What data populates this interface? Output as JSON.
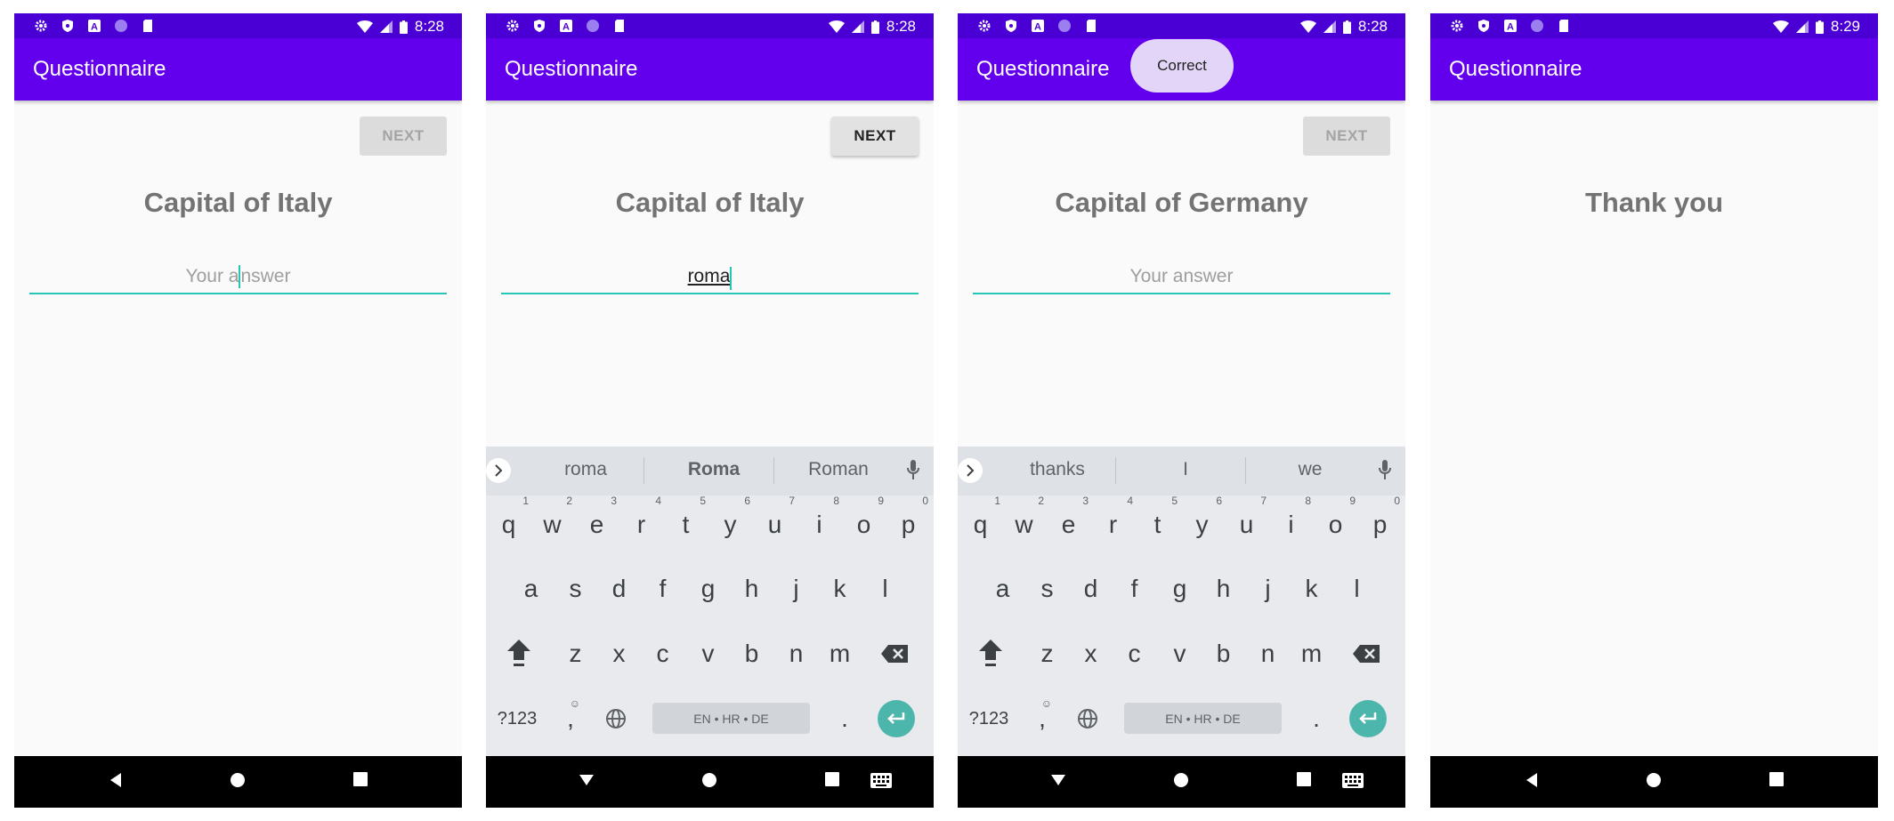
{
  "common": {
    "app_title": "Questionnaire",
    "next_label": "NEXT",
    "placeholder": "Your answer"
  },
  "screens": [
    {
      "status_time": "8:28",
      "question": "Capital of Italy",
      "answer_placeholder_part1": "Your a",
      "answer_placeholder_part2": "nswer",
      "next_enabled": false
    },
    {
      "status_time": "8:28",
      "question": "Capital of Italy",
      "answer_value": "roma",
      "next_enabled": true,
      "suggestions": [
        "roma",
        "Roma",
        "Roman"
      ]
    },
    {
      "status_time": "8:28",
      "question": "Capital of Germany",
      "answer_placeholder": "Your answer",
      "next_enabled": false,
      "toast": "Correct",
      "suggestions": [
        "thanks",
        "I",
        "we"
      ]
    },
    {
      "status_time": "8:29",
      "question": "Thank you"
    }
  ],
  "keyboard": {
    "row1": [
      {
        "key": "q",
        "num": "1"
      },
      {
        "key": "w",
        "num": "2"
      },
      {
        "key": "e",
        "num": "3"
      },
      {
        "key": "r",
        "num": "4"
      },
      {
        "key": "t",
        "num": "5"
      },
      {
        "key": "y",
        "num": "6"
      },
      {
        "key": "u",
        "num": "7"
      },
      {
        "key": "i",
        "num": "8"
      },
      {
        "key": "o",
        "num": "9"
      },
      {
        "key": "p",
        "num": "0"
      }
    ],
    "row2": [
      "a",
      "s",
      "d",
      "f",
      "g",
      "h",
      "j",
      "k",
      "l"
    ],
    "row3": [
      "z",
      "x",
      "c",
      "v",
      "b",
      "n",
      "m"
    ],
    "symbols_label": "?123",
    "comma_label": ",",
    "period_label": ".",
    "space_label": "EN • HR • DE"
  },
  "icons": {
    "status_left": [
      "settings-icon",
      "shield-icon",
      "a-icon",
      "circle-icon",
      "sd-card-icon"
    ],
    "status_right": [
      "wifi-icon",
      "signal-icon",
      "battery-icon"
    ],
    "nav": [
      "back-icon",
      "home-icon",
      "recents-icon"
    ]
  },
  "colors": {
    "status_bar": "#4a00d4",
    "app_bar": "#6200ee",
    "accent": "#26c6b6",
    "toast_bg": "#e2d5f7",
    "enter_key": "#4db6ac"
  }
}
